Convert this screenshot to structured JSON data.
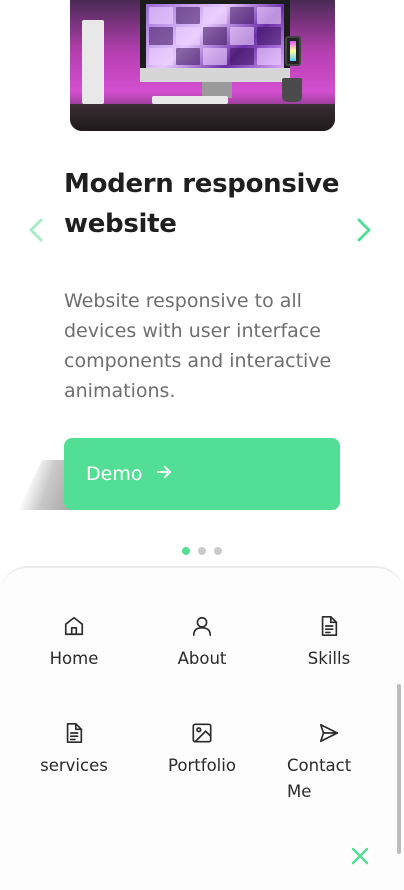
{
  "colors": {
    "accent": "#52de94",
    "title": "#1f1f1f",
    "body_text": "#6e6e6e"
  },
  "carousel": {
    "image_alt": "Desktop computer on a desk with pink lighting",
    "title": "Modern responsive website",
    "description": "Website responsive to all devices with user interface components and interactive animations.",
    "button_label": "Demo",
    "prev_icon": "chevron-left-icon",
    "next_icon": "chevron-right-icon",
    "dots": [
      {
        "active": true
      },
      {
        "active": false
      },
      {
        "active": false
      }
    ]
  },
  "nav": {
    "items": [
      {
        "label": "Home",
        "icon": "home-icon"
      },
      {
        "label": "About",
        "icon": "user-icon"
      },
      {
        "label": "Skills",
        "icon": "file-icon"
      },
      {
        "label": "services",
        "icon": "file-icon"
      },
      {
        "label": "Portfolio",
        "icon": "image-icon"
      },
      {
        "label": "Contact Me",
        "icon": "send-icon"
      }
    ],
    "close_icon": "close-icon"
  }
}
